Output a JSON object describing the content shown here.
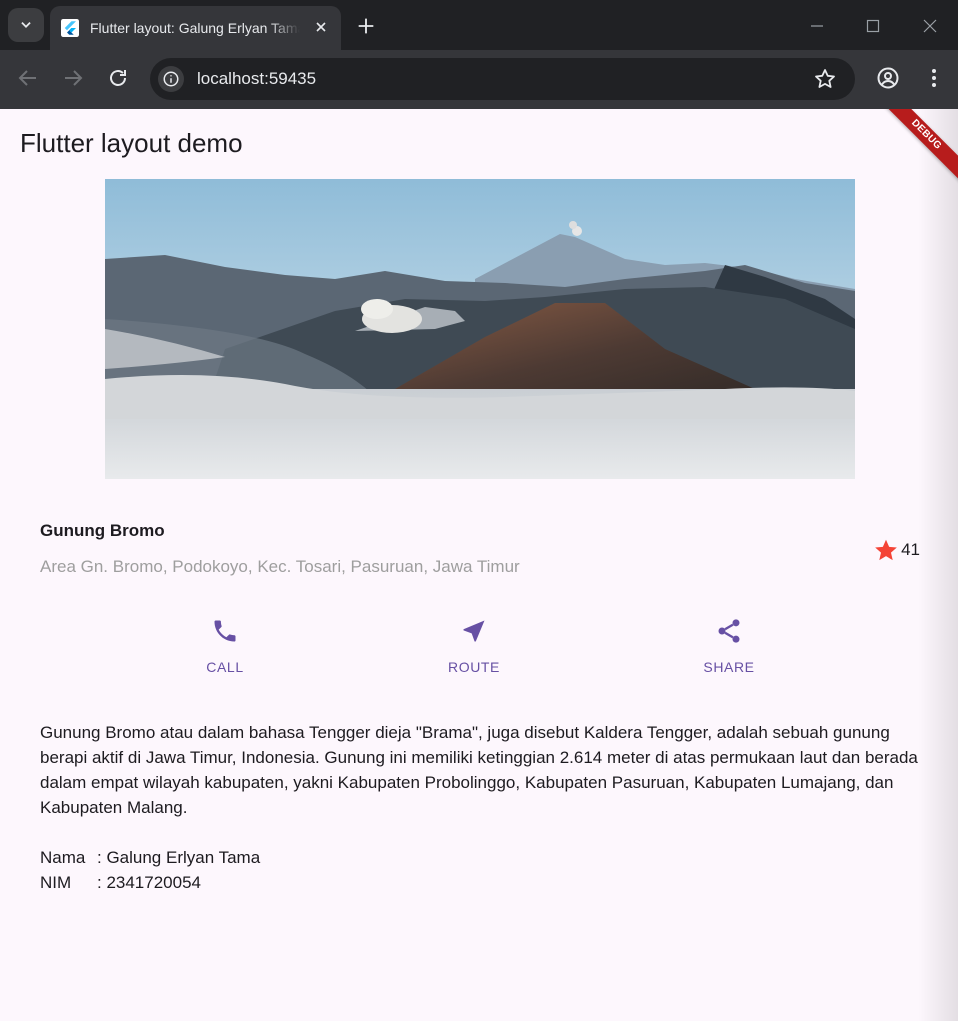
{
  "browser": {
    "tab_title": "Flutter layout: Galung Erlyan Tama",
    "url": "localhost:59435"
  },
  "app": {
    "title": "Flutter layout demo",
    "debug_banner": "DEBUG",
    "place": {
      "name": "Gunung Bromo",
      "address": "Area Gn. Bromo, Podokoyo, Kec. Tosari, Pasuruan, Jawa Timur",
      "rating_count": "41"
    },
    "actions": [
      {
        "label": "CALL",
        "icon": "call-icon"
      },
      {
        "label": "ROUTE",
        "icon": "near-me-icon"
      },
      {
        "label": "SHARE",
        "icon": "share-icon"
      }
    ],
    "description": "Gunung Bromo atau dalam bahasa Tengger dieja \"Brama\", juga disebut Kaldera Tengger, adalah sebuah gunung berapi aktif di Jawa Timur, Indonesia. Gunung ini memiliki ketinggian 2.614 meter di atas permukaan laut dan berada dalam empat wilayah kabupaten, yakni Kabupaten Probolinggo, Kabupaten Pasuruan, Kabupaten Lumajang, dan Kabupaten Malang.",
    "credits": {
      "name_label": "Nama",
      "name_value": ": Galung Erlyan Tama",
      "nim_label": "NIM",
      "nim_value": ": 2341720054"
    }
  },
  "colors": {
    "accent": "#6750a4",
    "star": "#f44336",
    "background": "#fdf7fd"
  }
}
